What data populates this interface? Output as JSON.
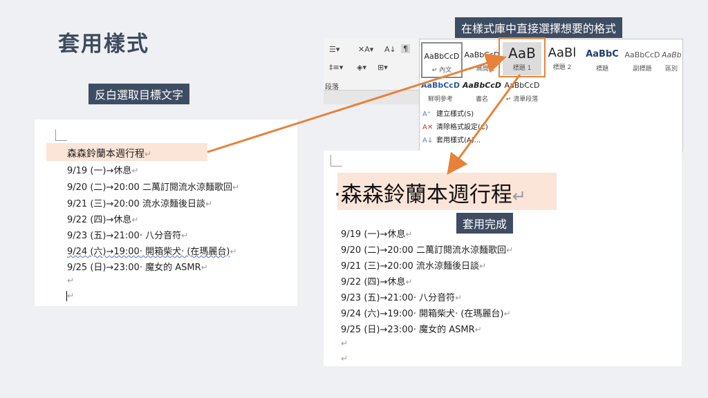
{
  "slide": {
    "title": "套用樣式",
    "label_select": "反白選取目標文字",
    "label_gallery": "在樣式庫中直接選擇想要的格式",
    "label_done": "套用完成"
  },
  "document": {
    "title": "森森鈴蘭本週行程",
    "lines": [
      "9/19 (一)→休息",
      "9/20 (二)→20:00 二萬訂閱流水涼麵歌回",
      "9/21 (三)→20:00 流水涼麵後日談",
      "9/22 (四)→休息",
      "9/23 (五)→21:00· 八分音符",
      "9/24 (六)→19:00· 開箱柴犬· (在瑪麗台)",
      "9/25 (日)→23:00· 魔女的 ASMR"
    ],
    "para_mark": "↵"
  },
  "ribbon": {
    "group_label": "段落"
  },
  "style_gallery": {
    "row1": [
      {
        "sample": "AaBbCcD",
        "name": "↵ 內文"
      },
      {
        "sample": "AaBbCcD",
        "name": "↵ 無間距"
      },
      {
        "sample": "AaB",
        "name": "標題 1"
      },
      {
        "sample": "AaBl",
        "name": "標題 2"
      },
      {
        "sample": "AaBbC",
        "name": "標題"
      },
      {
        "sample": "AaBbCcD",
        "name": "副標題"
      },
      {
        "sample": "AaBb",
        "name": "區別"
      }
    ],
    "row2": [
      {
        "sample": "AaBbCcD",
        "name": "鮮明參考"
      },
      {
        "sample": "AaBbCcD",
        "name": "書名"
      },
      {
        "sample": "AaBbCcD",
        "name": "↵ 清單段落"
      }
    ],
    "menu": [
      {
        "icon": "create-style-icon",
        "label": "建立樣式(S)"
      },
      {
        "icon": "clear-format-icon",
        "label": "清除格式設定(C)"
      },
      {
        "icon": "apply-style-icon",
        "label": "套用樣式(A)..."
      }
    ]
  },
  "colors": {
    "label_bg": "#3f4d63",
    "highlight": "#fbe4d8",
    "arrow": "#e6823a",
    "title": "#3e4a5e"
  }
}
